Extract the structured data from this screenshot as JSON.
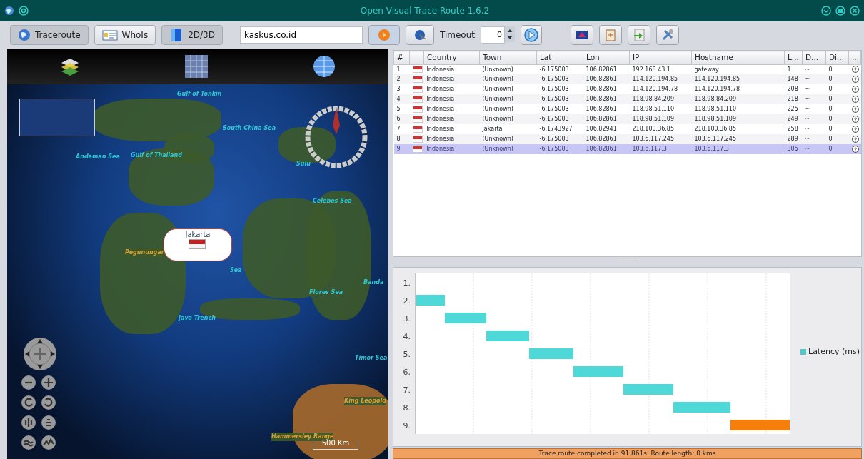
{
  "window": {
    "title": "Open Visual Trace Route 1.6.2"
  },
  "toolbar": {
    "modes": [
      {
        "label": "Traceroute",
        "selected": true
      },
      {
        "label": "WhoIs",
        "selected": false
      },
      {
        "label": "2D/3D",
        "selected": true
      }
    ],
    "host": {
      "value": "kaskus.co.id"
    },
    "timeout_label": "Timeout",
    "timeout": {
      "value": "0"
    }
  },
  "map": {
    "labels": [
      {
        "text": "Gulf of Tonkin",
        "kind": "sea"
      },
      {
        "text": "South China Sea",
        "kind": "sea"
      },
      {
        "text": "Andaman Sea",
        "kind": "sea"
      },
      {
        "text": "Gulf of Thailand",
        "kind": "sea"
      },
      {
        "text": "Sulu",
        "kind": "sea"
      },
      {
        "text": "Celebes Sea",
        "kind": "sea"
      },
      {
        "text": "Pegunungan",
        "kind": "land"
      },
      {
        "text": "Sea",
        "kind": "sea"
      },
      {
        "text": "Banda",
        "kind": "sea"
      },
      {
        "text": "Flores Sea",
        "kind": "sea"
      },
      {
        "text": "Java Trench",
        "kind": "sea"
      },
      {
        "text": "Timor Sea",
        "kind": "sea"
      },
      {
        "text": "King Leopold",
        "kind": "land"
      },
      {
        "text": "Hammersley Range",
        "kind": "land"
      }
    ],
    "marker": {
      "town": "Jakarta"
    },
    "scale": "500 Km"
  },
  "table": {
    "columns": [
      "#",
      "Country",
      "Town",
      "Lat",
      "Lon",
      "IP",
      "Hostname",
      "L...",
      "D...",
      "Di...",
      "..."
    ],
    "rows": [
      {
        "num": "1",
        "country": "Indonesia",
        "town": "(Unknown)",
        "lat": "-6.175003",
        "lon": "106.82861",
        "ip": "192.168.43.1",
        "hostname": "gateway",
        "latency": "1",
        "dns": "~",
        "dist": "0",
        "selected": false
      },
      {
        "num": "2",
        "country": "Indonesia",
        "town": "(Unknown)",
        "lat": "-6.175003",
        "lon": "106.82861",
        "ip": "114.120.194.85",
        "hostname": "114.120.194.85",
        "latency": "148",
        "dns": "~",
        "dist": "0",
        "selected": false
      },
      {
        "num": "3",
        "country": "Indonesia",
        "town": "(Unknown)",
        "lat": "-6.175003",
        "lon": "106.82861",
        "ip": "114.120.194.78",
        "hostname": "114.120.194.78",
        "latency": "208",
        "dns": "~",
        "dist": "0",
        "selected": false
      },
      {
        "num": "4",
        "country": "Indonesia",
        "town": "(Unknown)",
        "lat": "-6.175003",
        "lon": "106.82861",
        "ip": "118.98.84.209",
        "hostname": "118.98.84.209",
        "latency": "218",
        "dns": "~",
        "dist": "0",
        "selected": false
      },
      {
        "num": "5",
        "country": "Indonesia",
        "town": "(Unknown)",
        "lat": "-6.175003",
        "lon": "106.82861",
        "ip": "118.98.51.110",
        "hostname": "118.98.51.110",
        "latency": "225",
        "dns": "~",
        "dist": "0",
        "selected": false
      },
      {
        "num": "6",
        "country": "Indonesia",
        "town": "(Unknown)",
        "lat": "-6.175003",
        "lon": "106.82861",
        "ip": "118.98.51.109",
        "hostname": "118.98.51.109",
        "latency": "249",
        "dns": "~",
        "dist": "0",
        "selected": false
      },
      {
        "num": "7",
        "country": "Indonesia",
        "town": "Jakarta",
        "lat": "-6.1743927",
        "lon": "106.82941",
        "ip": "218.100.36.85",
        "hostname": "218.100.36.85",
        "latency": "258",
        "dns": "~",
        "dist": "0",
        "selected": false
      },
      {
        "num": "8",
        "country": "Indonesia",
        "town": "(Unknown)",
        "lat": "-6.175003",
        "lon": "106.82861",
        "ip": "103.6.117.245",
        "hostname": "103.6.117.245",
        "latency": "289",
        "dns": "~",
        "dist": "0",
        "selected": false
      },
      {
        "num": "9",
        "country": "Indonesia",
        "town": "(Unknown)",
        "lat": "-6.175003",
        "lon": "106.82861",
        "ip": "103.6.117.3",
        "hostname": "103.6.117.3",
        "latency": "305",
        "dns": "~",
        "dist": "0",
        "selected": true
      }
    ]
  },
  "chart": {
    "row_labels": [
      "1.",
      "2.",
      "3.",
      "4.",
      "5.",
      "6.",
      "7.",
      "8.",
      "9."
    ],
    "legend": "Latency (ms)"
  },
  "status_bar": "Trace route completed in 91.861s. Route length: 0 kms"
}
